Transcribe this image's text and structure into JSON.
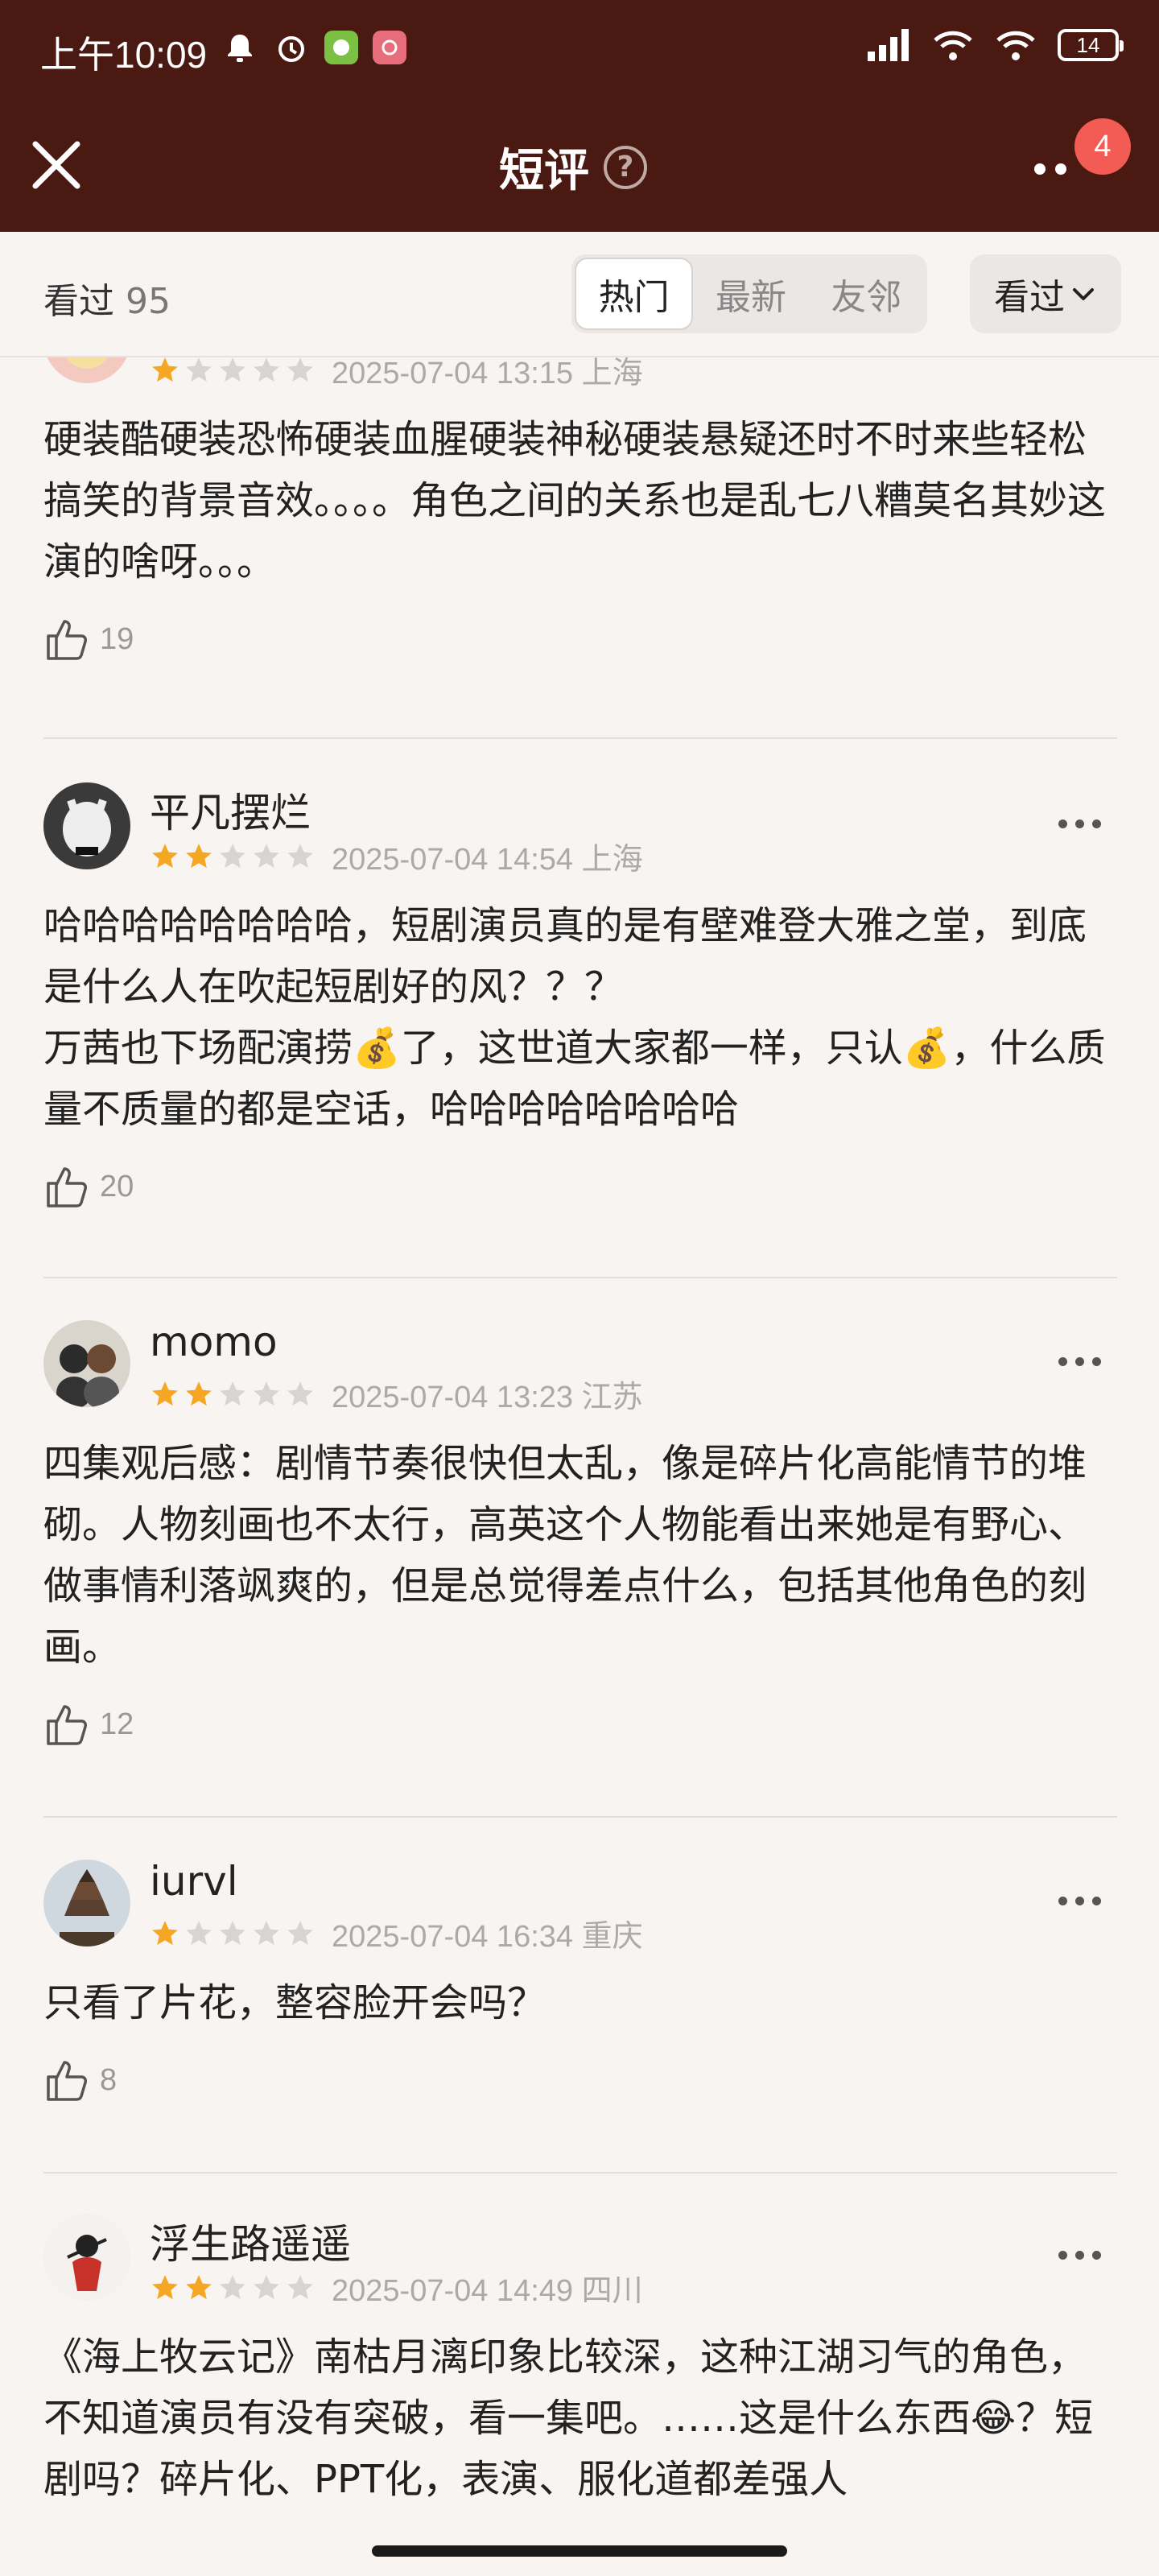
{
  "status": {
    "time": "上午10:09",
    "battery": "14"
  },
  "header": {
    "title": "短评",
    "help": "?",
    "badge_count": "4"
  },
  "filter": {
    "watched_label": "看过",
    "watched_count": "95",
    "tabs": [
      "热门",
      "最新",
      "友邻"
    ],
    "active_tab": "热门",
    "sort_label": "看过"
  },
  "comments": [
    {
      "username": "",
      "rating": 1,
      "date": "2025-07-04 13:15 上海",
      "text": "硬装酷硬装恐怖硬装血腥硬装神秘硬装悬疑还时不时来些轻松搞笑的背景音效。。。。角色之间的关系也是乱七八糟莫名其妙这演的啥呀。。。",
      "likes": "19"
    },
    {
      "username": "平凡摆烂",
      "rating": 2,
      "date": "2025-07-04 14:54 上海",
      "text": "哈哈哈哈哈哈哈哈，短剧演员真的是有壁难登大雅之堂，到底是什么人在吹起短剧好的风？？？\n万茜也下场配演捞💰了，这世道大家都一样，只认💰，什么质量不质量的都是空话，哈哈哈哈哈哈哈哈",
      "likes": "20"
    },
    {
      "username": "momo",
      "rating": 2,
      "date": "2025-07-04 13:23 江苏",
      "text": "四集观后感：剧情节奏很快但太乱，像是碎片化高能情节的堆砌。人物刻画也不太行，高英这个人物能看出来她是有野心、做事情利落飒爽的，但是总觉得差点什么，包括其他角色的刻画。",
      "likes": "12"
    },
    {
      "username": "iurvl",
      "rating": 1,
      "date": "2025-07-04 16:34 重庆",
      "text": "只看了片花，整容脸开会吗？",
      "likes": "8"
    },
    {
      "username": "浮生路遥遥",
      "rating": 2,
      "date": "2025-07-04 14:49 四川",
      "text": "《海上牧云记》南枯月漓印象比较深，这种江湖习气的角色，不知道演员有没有突破，看一集吧。……这是什么东西😂？短剧吗？碎片化、PPT化，表演、服化道都差强人",
      "likes": ""
    }
  ],
  "colors": {
    "header_bg": "#4a1a12",
    "star_on": "#f5a623",
    "star_off": "#d8d4d2",
    "badge": "#f25c54"
  }
}
